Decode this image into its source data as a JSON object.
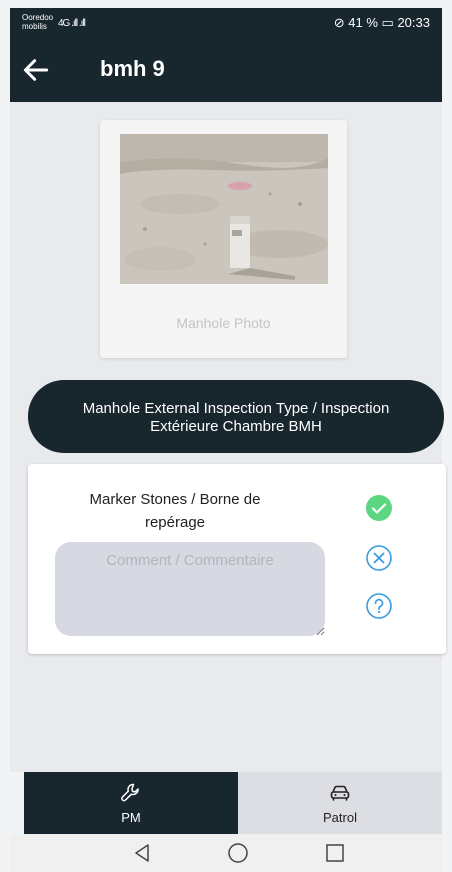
{
  "status_bar": {
    "carrier_line1": "Ooredoo",
    "carrier_line2": "mobilis",
    "signal": "4G .ıll .ıll",
    "battery": "41 %",
    "time": "20:33"
  },
  "app_bar": {
    "title": "bmh 9"
  },
  "photo": {
    "label": "Manhole Photo"
  },
  "inspection_type": {
    "label": "Manhole External Inspection Type / Inspection Extérieure Chambre BMH"
  },
  "item": {
    "title": "Marker Stones / Borne de repérage",
    "comment_placeholder": "Comment / Commentaire",
    "comment_value": ""
  },
  "bottom_nav": {
    "pm_label": "PM",
    "patrol_label": "Patrol"
  },
  "icons": {
    "back": "back-arrow-icon",
    "ok": "check-circle-icon",
    "not_ok": "x-circle-icon",
    "unknown": "question-circle-icon",
    "pm": "wrench-icon",
    "patrol": "car-icon"
  },
  "colors": {
    "primary_dark": "#18262e",
    "success_green": "#5cd680",
    "info_blue": "#3b9be0",
    "comment_bg": "#d6d8e2"
  }
}
